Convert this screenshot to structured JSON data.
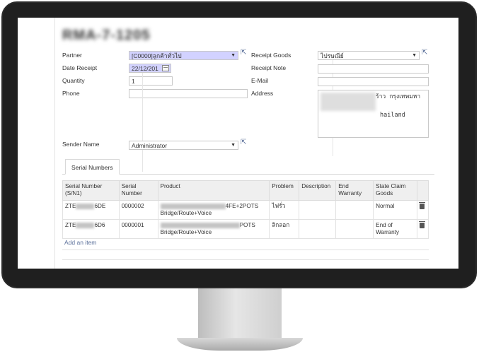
{
  "form": {
    "title": "RMA-7-1205",
    "partner_label": "Partner",
    "partner_value": "[C0000]ลูกค้าทั่วไป",
    "date_receipt_label": "Date Receipt",
    "date_receipt_value": "22/12/201",
    "quantity_label": "Quantity",
    "quantity_value": "1",
    "phone_label": "Phone",
    "phone_value": "",
    "sender_name_label": "Sender Name",
    "sender_name_value": "Administrator",
    "receipt_goods_label": "Receipt Goods",
    "receipt_goods_value": "ไปรษณีย์",
    "receipt_note_label": "Receipt Note",
    "receipt_note_value": "",
    "email_label": "E-Mail",
    "email_value": "",
    "address_label": "Address",
    "address_line1": "ร้าว กรุงเทพมหา",
    "address_line2": "hailand"
  },
  "tabs": [
    "Serial Numbers"
  ],
  "table": {
    "headers": [
      "Serial Number (S/N1)",
      "Serial Number",
      "Product",
      "Problem",
      "Description",
      "End Warranty",
      "State Claim Goods"
    ],
    "rows": [
      {
        "serial_prefix": "ZTE",
        "serial_suffix": "6DE",
        "serial_number": "0000002",
        "product_line1": "4FE+2POTS",
        "product_line2": "Bridge/Route+Voice",
        "problem": "ไฟรั่ว",
        "description": "",
        "end_warranty": "",
        "state": "Normal"
      },
      {
        "serial_prefix": "ZTE",
        "serial_suffix": "6D6",
        "serial_number": "0000001",
        "product_line1": "POTS",
        "product_line2": "Bridge/Route+Voice",
        "problem": "ลิกลอก",
        "description": "",
        "end_warranty": "",
        "state": "End of Warranty"
      }
    ],
    "add_item_label": "Add an item"
  },
  "colors": {
    "required_field": "#d2d2ff",
    "link": "#5a6f9a",
    "bezel": "#1f1f1f"
  }
}
